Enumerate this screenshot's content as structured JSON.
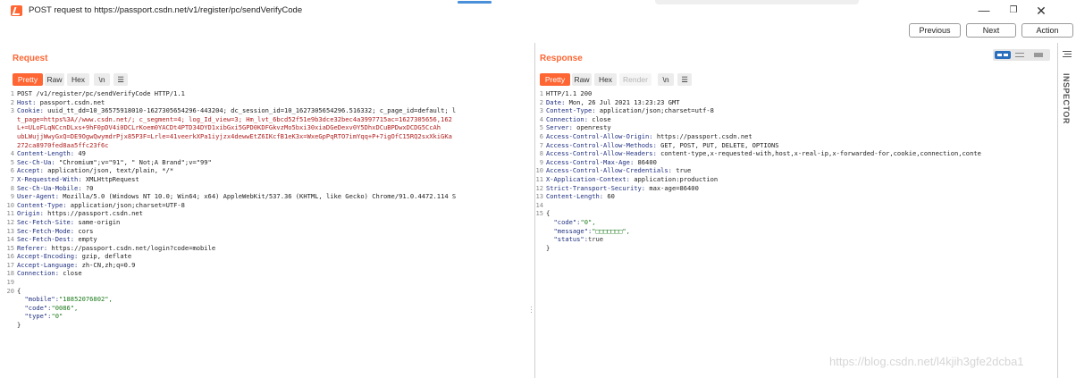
{
  "window": {
    "title": "POST request to https://passport.csdn.net/v1/register/pc/sendVerifyCode",
    "minimize": "—",
    "maximize": "❐",
    "close": "✕"
  },
  "nav": {
    "previous": "Previous",
    "next": "Next",
    "action": "Action"
  },
  "request": {
    "title": "Request",
    "views": [
      "Pretty",
      "Raw",
      "Hex",
      "\\n",
      "☰"
    ],
    "lines": [
      {
        "n": "1",
        "k": "",
        "v": "POST /v1/register/pc/sendVerifyCode HTTP/1.1",
        "t": "plain"
      },
      {
        "n": "2",
        "k": "Host:",
        "v": " passport.csdn.net",
        "t": "header"
      },
      {
        "n": "3",
        "k": "Cookie:",
        "v": " uuid_tt_dd=10_36575918010-1627305654296-443204; dc_session_id=10_1627305654296.516332; c_page_id=default; l",
        "t": "header"
      },
      {
        "n": "",
        "k": "",
        "v": "t_page=https%3A//www.csdn.net/; c_segment=4; log_Id_view=3; Hm_lvt_6bcd52f51e9b3dce32bec4a3997715ac=1627305656,162",
        "t": "cookie"
      },
      {
        "n": "",
        "k": "",
        "v": "L+=ULoFLqNCcnDLxs+9hF0pDV4i0DCLrKoem0YACDt4PTD34DYD1xibGxi5GPD0KDFGkvzMo5bxi30xiaDGeDexv0Y5DhxDCuBPDwxDCDG5CcAh",
        "t": "cookie"
      },
      {
        "n": "",
        "k": "",
        "v": "ubLWujjWwyGxQ=DE9OgwQwymdrPjx85P3F=Lrle=41veerkXPa1iyjzx4dewwEtZ6IKcfB1eK3x=WxeGpPqRTO7imYqq+P+7igOfC15RQ2sxXkiGKa",
        "t": "cookie"
      },
      {
        "n": "",
        "k": "",
        "v": "272ca8970fed8aa5ffc23f6c",
        "t": "cookie"
      },
      {
        "n": "4",
        "k": "Content-Length:",
        "v": " 49",
        "t": "header"
      },
      {
        "n": "5",
        "k": "Sec-Ch-Ua:",
        "v": " \"Chromium\";v=\"91\", \" Not;A Brand\";v=\"99\"",
        "t": "header"
      },
      {
        "n": "6",
        "k": "Accept:",
        "v": " application/json, text/plain, */*",
        "t": "header"
      },
      {
        "n": "7",
        "k": "X-Requested-With:",
        "v": " XMLHttpRequest",
        "t": "header"
      },
      {
        "n": "8",
        "k": "Sec-Ch-Ua-Mobile:",
        "v": " ?0",
        "t": "header"
      },
      {
        "n": "9",
        "k": "User-Agent:",
        "v": " Mozilla/5.0 (Windows NT 10.0; Win64; x64) AppleWebKit/537.36 (KHTML, like Gecko) Chrome/91.0.4472.114 S",
        "t": "header"
      },
      {
        "n": "10",
        "k": "Content-Type:",
        "v": " application/json;charset=UTF-8",
        "t": "header"
      },
      {
        "n": "11",
        "k": "Origin:",
        "v": " https://passport.csdn.net",
        "t": "header"
      },
      {
        "n": "12",
        "k": "Sec-Fetch-Site:",
        "v": " same-origin",
        "t": "header"
      },
      {
        "n": "13",
        "k": "Sec-Fetch-Mode:",
        "v": " cors",
        "t": "header"
      },
      {
        "n": "14",
        "k": "Sec-Fetch-Dest:",
        "v": " empty",
        "t": "header"
      },
      {
        "n": "15",
        "k": "Referer:",
        "v": " https://passport.csdn.net/login?code=mobile",
        "t": "header"
      },
      {
        "n": "16",
        "k": "Accept-Encoding:",
        "v": " gzip, deflate",
        "t": "header"
      },
      {
        "n": "17",
        "k": "Accept-Language:",
        "v": " zh-CN,zh;q=0.9",
        "t": "header"
      },
      {
        "n": "18",
        "k": "Connection:",
        "v": " close",
        "t": "header"
      },
      {
        "n": "19",
        "k": "",
        "v": "",
        "t": "plain"
      },
      {
        "n": "20",
        "k": "",
        "v": "{",
        "t": "plain"
      },
      {
        "n": "",
        "k": "  \"mobile\":",
        "v": "\"18852076802\",",
        "t": "json"
      },
      {
        "n": "",
        "k": "  \"code\":",
        "v": "\"0086\",",
        "t": "json"
      },
      {
        "n": "",
        "k": "  \"type\":",
        "v": "\"0\"",
        "t": "json"
      },
      {
        "n": "",
        "k": "",
        "v": "}",
        "t": "plain"
      }
    ]
  },
  "response": {
    "title": "Response",
    "views": [
      "Pretty",
      "Raw",
      "Hex",
      "Render",
      "\\n",
      "☰"
    ],
    "lines": [
      {
        "n": "1",
        "k": "",
        "v": "HTTP/1.1 200",
        "t": "plain"
      },
      {
        "n": "2",
        "k": "Date:",
        "v": " Mon, 26 Jul 2021 13:23:23 GMT",
        "t": "header"
      },
      {
        "n": "3",
        "k": "Content-Type:",
        "v": " application/json;charset=utf-8",
        "t": "header"
      },
      {
        "n": "4",
        "k": "Connection:",
        "v": " close",
        "t": "header"
      },
      {
        "n": "5",
        "k": "Server:",
        "v": " openresty",
        "t": "header"
      },
      {
        "n": "6",
        "k": "Access-Control-Allow-Origin:",
        "v": " https://passport.csdn.net",
        "t": "header"
      },
      {
        "n": "7",
        "k": "Access-Control-Allow-Methods:",
        "v": " GET, POST, PUT, DELETE, OPTIONS",
        "t": "header"
      },
      {
        "n": "8",
        "k": "Access-Control-Allow-Headers:",
        "v": " content-type,x-requested-with,host,x-real-ip,x-forwarded-for,cookie,connection,conte",
        "t": "header"
      },
      {
        "n": "9",
        "k": "Access-Control-Max-Age:",
        "v": " 86400",
        "t": "header"
      },
      {
        "n": "10",
        "k": "Access-Control-Allow-Credentials:",
        "v": " true",
        "t": "header"
      },
      {
        "n": "11",
        "k": "X-Application-Context:",
        "v": " application:production",
        "t": "header"
      },
      {
        "n": "12",
        "k": "Strict-Transport-Security:",
        "v": " max-age=86400",
        "t": "header"
      },
      {
        "n": "13",
        "k": "Content-Length:",
        "v": " 60",
        "t": "header"
      },
      {
        "n": "14",
        "k": "",
        "v": "",
        "t": "plain"
      },
      {
        "n": "15",
        "k": "",
        "v": "{",
        "t": "plain"
      },
      {
        "n": "",
        "k": "  \"code\":",
        "v": "\"0\",",
        "t": "json"
      },
      {
        "n": "",
        "k": "  \"message\":",
        "v": "\"□□□□□□□\",",
        "t": "json"
      },
      {
        "n": "",
        "k": "  \"status\":",
        "v": "true",
        "t": "json"
      },
      {
        "n": "",
        "k": "",
        "v": "}",
        "t": "plain"
      }
    ]
  },
  "inspector": {
    "label": "INSPECTOR"
  },
  "watermark": "https://blog.csdn.net/l4kjih3gfe2dcba1",
  "colors": {
    "accent": "#ff6633",
    "header_key": "#1f2f80",
    "cookie": "#b01f1f",
    "json_string": "#1b7a1b"
  }
}
